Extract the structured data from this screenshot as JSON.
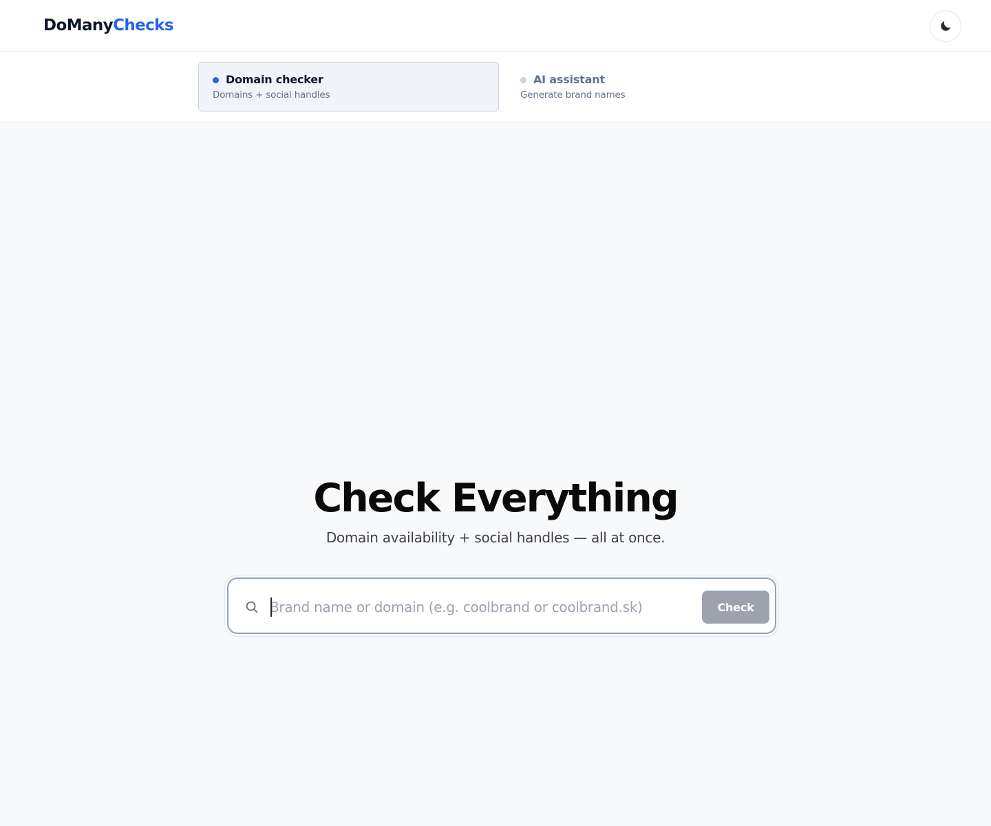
{
  "header": {
    "logo_part1": "DoMany",
    "logo_part2": "Checks",
    "theme_toggle_icon": "moon-icon"
  },
  "modes": [
    {
      "title": "Domain checker",
      "subtitle": "Domains + social handles",
      "active": true
    },
    {
      "title": "AI assistant",
      "subtitle": "Generate brand names",
      "active": false
    }
  ],
  "hero": {
    "title": "Check Everything",
    "subtitle": "Domain availability + social handles — all at once."
  },
  "search": {
    "placeholder": "Brand name or domain (e.g. coolbrand or coolbrand.sk)",
    "value": "",
    "button_label": "Check",
    "icon": "search-icon"
  },
  "colors": {
    "accent": "#2563eb",
    "button_disabled": "#9ca3af",
    "page_background": "#f8f9fb"
  }
}
